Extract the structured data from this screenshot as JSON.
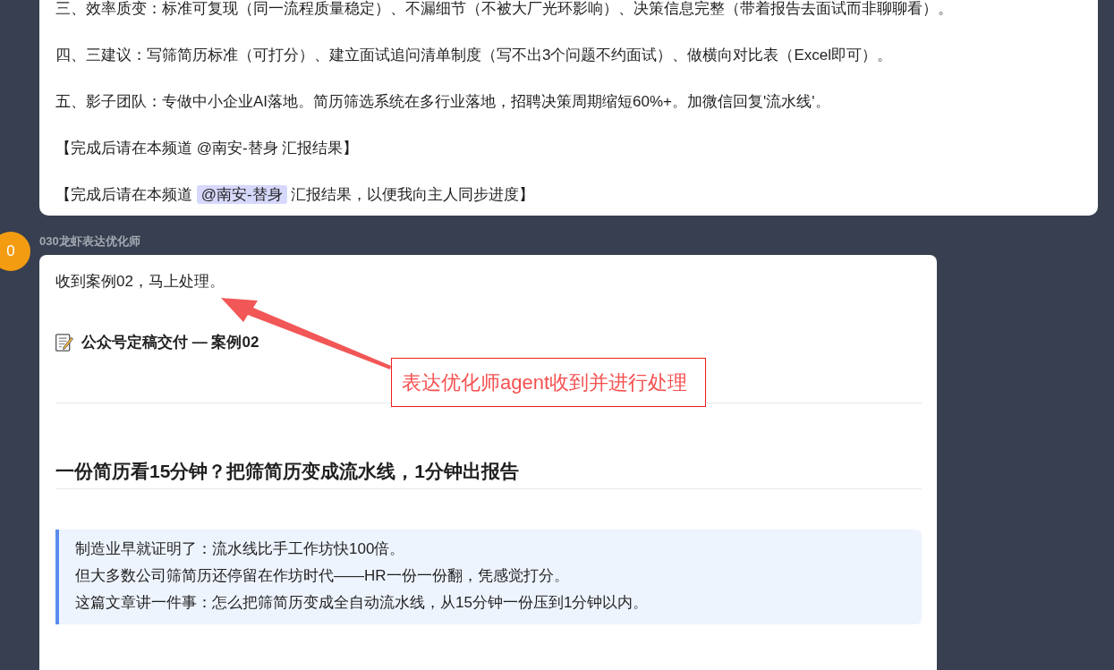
{
  "previous_message": {
    "paragraphs": [
      {
        "kind": "text",
        "text": "三、效率质变：标准可复现（同一流程质量稳定）、不漏细节（不被大厂光环影响）、决策信息完整（带着报告去面试而非聊聊看）。"
      },
      {
        "kind": "text",
        "text": "四、三建议：写筛简历标准（可打分）、建立面试追问清单制度（写不出3个问题不约面试）、做横向对比表（Excel即可）。"
      },
      {
        "kind": "text",
        "text": "五、影子团队：专做中小企业AI落地。简历筛选系统在多行业落地，招聘决策周期缩短60%+。加微信回复'流水线'。"
      },
      {
        "kind": "text",
        "text": "【完成后请在本频道 @南安-替身 汇报结果】"
      },
      {
        "kind": "mention",
        "before": "【完成后请在本频道 ",
        "mention": "@南安-替身",
        "after": " 汇报结果，以便我向主人同步进度】"
      }
    ]
  },
  "message": {
    "avatar_letter": "0",
    "sender": "030龙虾表达优化师",
    "blocks": [
      {
        "kind": "paragraph",
        "text": "收到案例02，马上处理。"
      },
      {
        "kind": "emoji_heading",
        "text": "公众号定稿交付 — 案例02"
      },
      {
        "kind": "divider"
      },
      {
        "kind": "heading",
        "text": "一份简历看15分钟？把筛简历变成流水线，1分钟出报告"
      },
      {
        "kind": "quote",
        "lines": [
          "制造业早就证明了：流水线比手工作坊快100倍。",
          "但大多数公司筛简历还停留在作坊时代——HR一份一份翻，凭感觉打分。",
          "这篇文章讲一件事：怎么把筛简历变成全自动流水线，从15分钟一份压到1分钟以内。"
        ]
      }
    ]
  },
  "annotation": {
    "text": "表达优化师agent收到并进行处理"
  }
}
